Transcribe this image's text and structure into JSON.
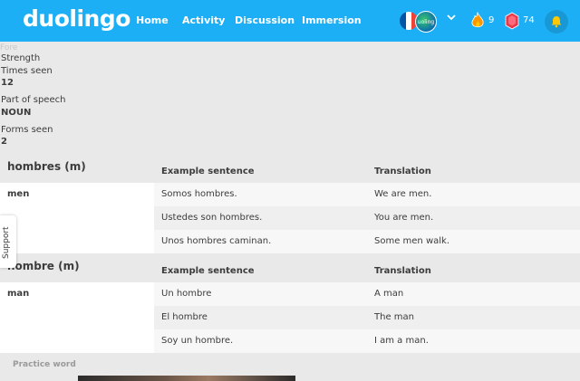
{
  "header": {
    "logo": "duolingo",
    "nav": [
      "Home",
      "Activity",
      "Discussion",
      "Immersion"
    ],
    "avatar_text": "uoling",
    "streak_count": "9",
    "gems_count": "74",
    "colors": {
      "bar": "#1caff6",
      "streak": "#ff9600",
      "gem": "#e6394b"
    }
  },
  "ghost_text": "Fore",
  "meta": {
    "strength_label": "Strength",
    "times_seen_label": "Times seen",
    "times_seen_value": "12",
    "part_of_speech_label": "Part of speech",
    "part_of_speech_value": "NOUN",
    "forms_seen_label": "Forms seen",
    "forms_seen_value": "2"
  },
  "forms": [
    {
      "heading": "hombres (m)",
      "meaning": "men",
      "col_example": "Example sentence",
      "col_translation": "Translation",
      "rows": [
        {
          "example": "Somos hombres.",
          "translation": "We are men."
        },
        {
          "example": "Ustedes son hombres.",
          "translation": "You are men."
        },
        {
          "example": "Unos hombres caminan.",
          "translation": "Some men walk."
        }
      ]
    },
    {
      "heading": "hombre (m)",
      "meaning": "man",
      "col_example": "Example sentence",
      "col_translation": "Translation",
      "rows": [
        {
          "example": "Un hombre",
          "translation": "A man"
        },
        {
          "example": "El hombre",
          "translation": "The man"
        },
        {
          "example": "Soy un hombre.",
          "translation": "I am a man."
        }
      ]
    }
  ],
  "support_label": "Support",
  "practice_label": "Practice word"
}
